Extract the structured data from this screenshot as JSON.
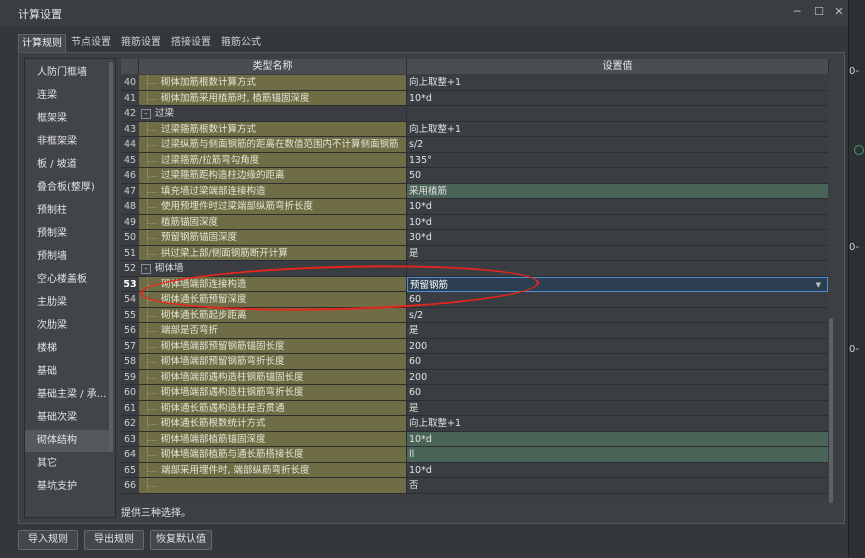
{
  "window": {
    "title": "计算设置",
    "controls": [
      "minimize-icon",
      "maximize-icon",
      "close-icon"
    ]
  },
  "tabs": [
    {
      "label": "计算规则",
      "active": true
    },
    {
      "label": "节点设置"
    },
    {
      "label": "箍筋设置"
    },
    {
      "label": "搭接设置"
    },
    {
      "label": "箍筋公式"
    }
  ],
  "sidebar": {
    "items": [
      {
        "label": "人防门框墙"
      },
      {
        "label": "连梁"
      },
      {
        "label": "框架梁"
      },
      {
        "label": "非框架梁"
      },
      {
        "label": "板 / 坡道"
      },
      {
        "label": "叠合板(整厚)"
      },
      {
        "label": "预制柱"
      },
      {
        "label": "预制梁"
      },
      {
        "label": "预制墙"
      },
      {
        "label": "空心楼盖板"
      },
      {
        "label": "主肋梁"
      },
      {
        "label": "次肋梁"
      },
      {
        "label": "楼梯"
      },
      {
        "label": "基础"
      },
      {
        "label": "基础主梁 / 承..."
      },
      {
        "label": "基础次梁"
      },
      {
        "label": "砌体结构",
        "active": true
      },
      {
        "label": "其它"
      },
      {
        "label": "基坑支护"
      }
    ]
  },
  "grid": {
    "header": {
      "name": "类型名称",
      "value": "设置值"
    },
    "rows": [
      {
        "num": "40",
        "name": "砌体加筋根数计算方式",
        "value": "向上取整+1"
      },
      {
        "num": "41",
        "name": "砌体加筋采用植筋时, 植筋锚固深度",
        "value": "10*d"
      },
      {
        "num": "42",
        "name": "过梁",
        "group": true,
        "toggle": "-",
        "value": ""
      },
      {
        "num": "43",
        "name": "过梁箍筋根数计算方式",
        "value": "向上取整+1"
      },
      {
        "num": "44",
        "name": "过梁纵筋与侧面钢筋的距离在数值范围内不计算侧面钢筋",
        "value": "s/2"
      },
      {
        "num": "45",
        "name": "过梁箍筋/拉筋弯勾角度",
        "value": "135°"
      },
      {
        "num": "46",
        "name": "过梁箍筋距构造柱边缘的距离",
        "value": "50"
      },
      {
        "num": "47",
        "name": "填充墙过梁端部连接构造",
        "value": "采用植筋",
        "hl": true
      },
      {
        "num": "48",
        "name": "使用预埋件时过梁端部纵筋弯折长度",
        "value": "10*d"
      },
      {
        "num": "49",
        "name": "植筋锚固深度",
        "value": "10*d"
      },
      {
        "num": "50",
        "name": "预留钢筋锚固深度",
        "value": "30*d"
      },
      {
        "num": "51",
        "name": "拱过梁上部/侧面钢筋断开计算",
        "value": "是"
      },
      {
        "num": "52",
        "name": "砌体墙",
        "group": true,
        "toggle": "-",
        "value": ""
      },
      {
        "num": "53",
        "name": "砌体墙端部连接构造",
        "value": "预留钢筋",
        "sel": true
      },
      {
        "num": "54",
        "name": "砌体通长筋预留深度",
        "value": "60"
      },
      {
        "num": "55",
        "name": "砌体通长筋起步距离",
        "value": "s/2"
      },
      {
        "num": "56",
        "name": "端部是否弯折",
        "value": "是"
      },
      {
        "num": "57",
        "name": "砌体墙端部预留钢筋锚固长度",
        "value": "200"
      },
      {
        "num": "58",
        "name": "砌体墙端部预留钢筋弯折长度",
        "value": "60"
      },
      {
        "num": "59",
        "name": "砌体墙端部遇构造柱钢筋锚固长度",
        "value": "200"
      },
      {
        "num": "60",
        "name": "砌体墙端部遇构造柱钢筋弯折长度",
        "value": "60"
      },
      {
        "num": "61",
        "name": "砌体通长筋遇构造柱是否贯通",
        "value": "是"
      },
      {
        "num": "62",
        "name": "砌体通长筋根数统计方式",
        "value": "向上取整+1"
      },
      {
        "num": "63",
        "name": "砌体墙端部植筋锚固深度",
        "value": "10*d",
        "hl": true
      },
      {
        "num": "64",
        "name": "砌体墙端部植筋与通长筋搭接长度",
        "value": "ll",
        "hl": true
      },
      {
        "num": "65",
        "name": "端部采用埋件时, 端部纵筋弯折长度",
        "value": "10*d"
      },
      {
        "num": "66",
        "name": "",
        "value": "否"
      }
    ]
  },
  "status_text": "提供三种选择。",
  "buttons": {
    "import": "导入规则",
    "export": "导出规则",
    "restore": "恢复默认值"
  },
  "background_marks": [
    "0-",
    "0-",
    "0-"
  ],
  "colors": {
    "name_column": "#6f6d45",
    "highlight_value": "#4a6458",
    "selection_border": "#4d8fd0",
    "annotation": "#e8251c"
  }
}
